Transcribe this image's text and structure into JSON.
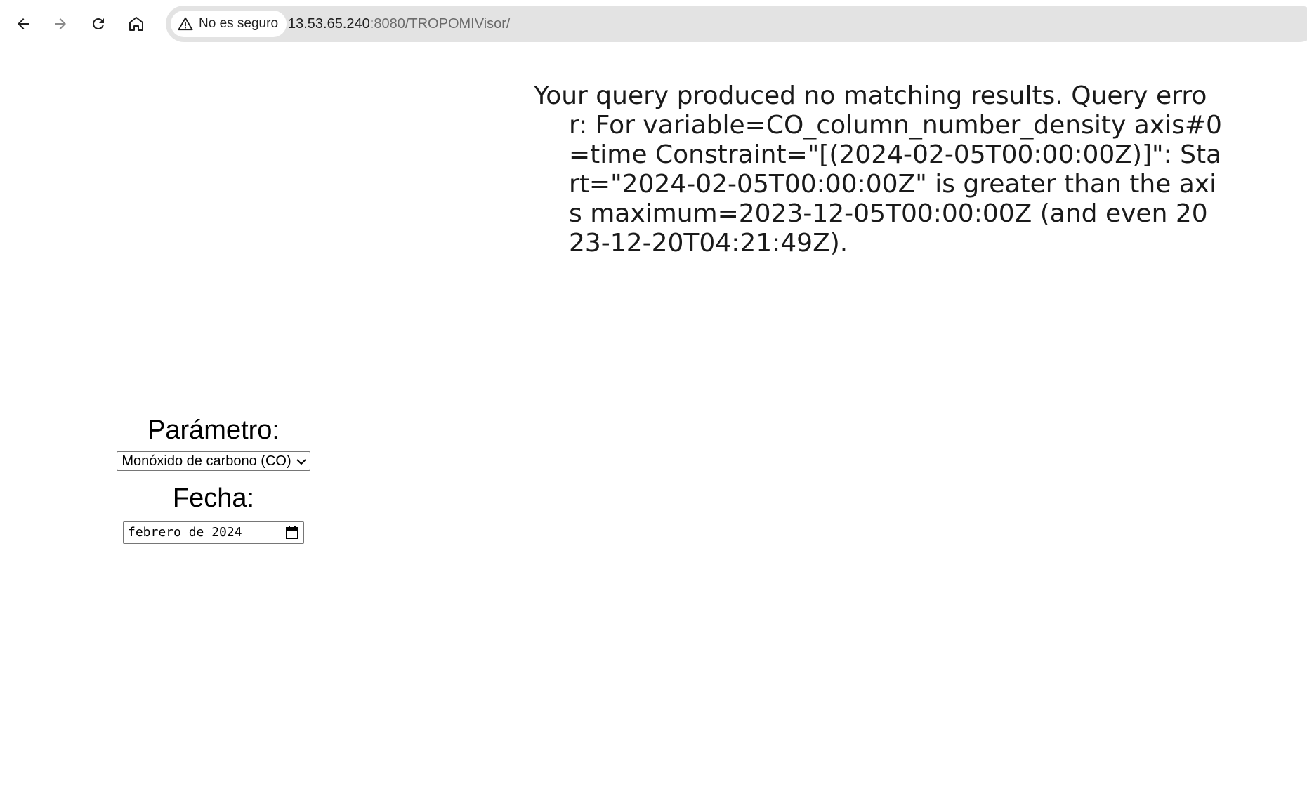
{
  "browser": {
    "security_label": "No es seguro",
    "url_host": "13.53.65.240",
    "url_rest": ":8080/TROPOMIVisor/",
    "icons": [
      "back-icon",
      "forward-icon",
      "reload-icon",
      "home-icon",
      "warning-icon"
    ]
  },
  "main": {
    "error_message": "Your query produced no matching results. Query error: For variable=CO_column_number_density axis#0=time Constraint=\"[(2024-02-05T00:00:00Z)]\": Start=\"2024-02-05T00:00:00Z\" is greater than the axis maximum=2023-12-05T00:00:00Z (and even 2023-12-20T04:21:49Z)."
  },
  "form": {
    "parametro_label": "Parámetro:",
    "parametro_value": "Monóxido de carbono (CO)",
    "fecha_label": "Fecha:",
    "fecha_value": "febrero de 2024"
  }
}
